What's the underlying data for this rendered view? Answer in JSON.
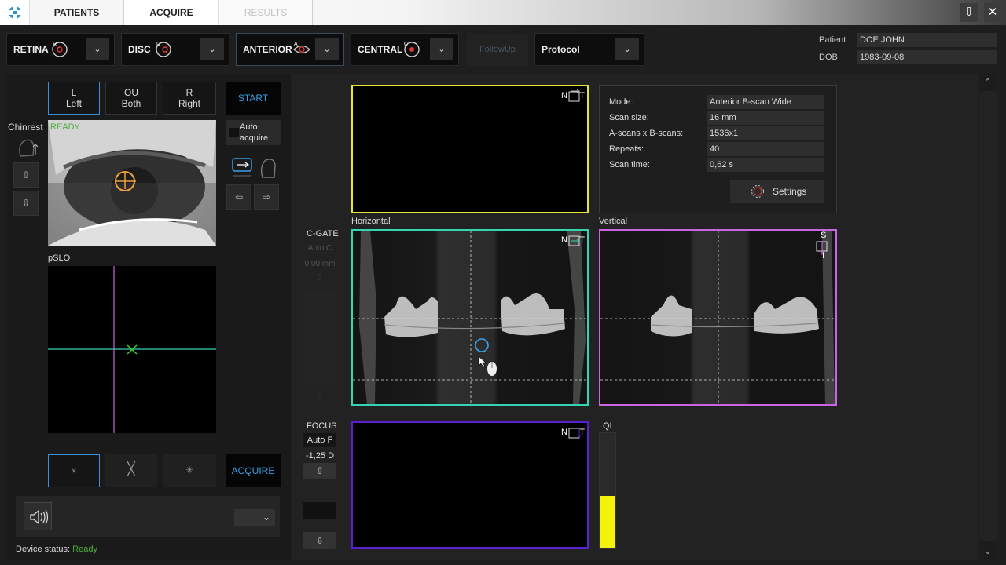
{
  "tabs": {
    "patients": "PATIENTS",
    "acquire": "ACQUIRE",
    "results": "RESULTS"
  },
  "modes": [
    {
      "label": "RETINA",
      "icon_letter": "R"
    },
    {
      "label": "DISC",
      "icon_letter": "D"
    },
    {
      "label": "ANTERIOR",
      "icon_letter": "A"
    },
    {
      "label": "CENTRAL",
      "icon_letter": "C"
    }
  ],
  "followup": "FollowUp",
  "protocol": "Protocol",
  "patient": {
    "label": "Patient",
    "value": "DOE JOHN",
    "dob_label": "DOB",
    "dob": "1983-09-08"
  },
  "eye": {
    "left_top": "L",
    "left_bottom": "Left",
    "both_top": "OU",
    "both_bottom": "Both",
    "right_top": "R",
    "right_bottom": "Right"
  },
  "start": "START",
  "chinrest": "Chinrest",
  "ready": "READY",
  "auto_acquire_1": "Auto",
  "auto_acquire_2": "acquire",
  "pslo": "pSLO",
  "acquire": "ACQUIRE",
  "device_status_label": "Device status:",
  "device_status": "Ready",
  "cgate": {
    "label": "C-GATE",
    "auto": "Auto C",
    "value": "0,00 mm"
  },
  "focus": {
    "label": "FOCUS",
    "auto": "Auto F",
    "value": "-1,25 D"
  },
  "scan_labels": {
    "horizontal": "Horizontal",
    "vertical": "Vertical",
    "qi": "QI"
  },
  "quality_index": 0.45,
  "orient": {
    "n": "N",
    "t": "T",
    "s": "S",
    "i": "I"
  },
  "info": {
    "rows": [
      {
        "label": "Mode:",
        "value": "Anterior B-scan Wide"
      },
      {
        "label": "Scan size:",
        "value": "16 mm"
      },
      {
        "label": "A-scans x B-scans:",
        "value": "1536x1"
      },
      {
        "label": "Repeats:",
        "value": "40"
      },
      {
        "label": "Scan time:",
        "value": "0,62 s"
      }
    ],
    "settings": "Settings"
  },
  "colors": {
    "yellow": "#e8e337",
    "teal": "#34d6b2",
    "magenta": "#c865e0",
    "purple": "#5a1fd0",
    "accent": "#3aa0e8",
    "green": "#4caf3a"
  }
}
